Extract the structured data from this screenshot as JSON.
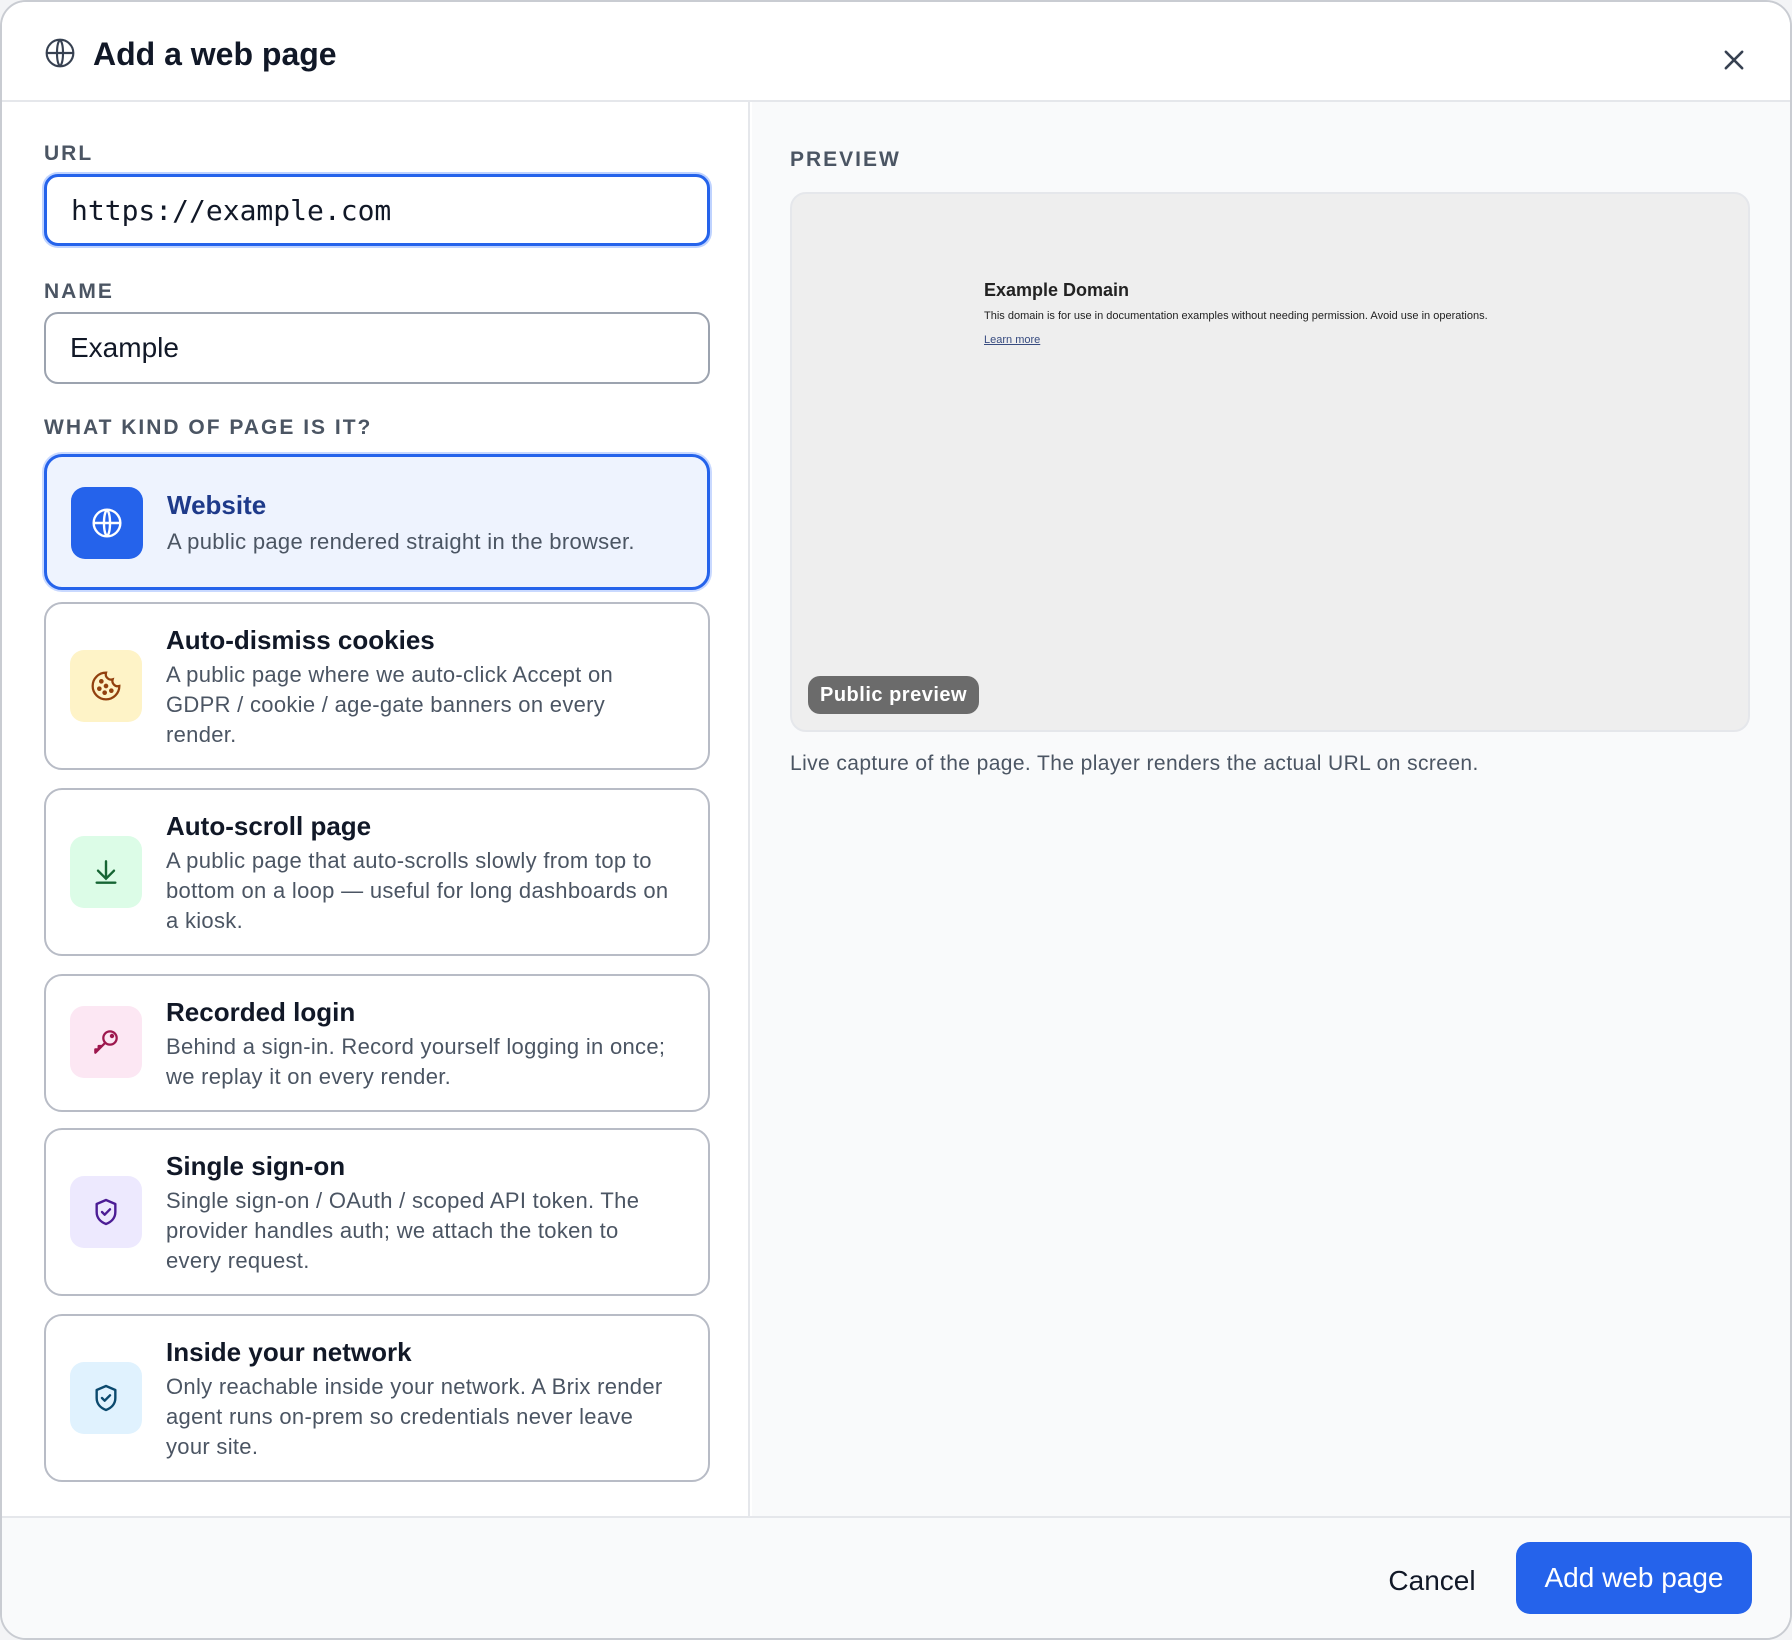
{
  "header": {
    "title": "Add a web page",
    "title_icon": "globe-icon",
    "close_icon": "close-icon"
  },
  "form": {
    "url_label": "URL",
    "url_value": "https://example.com",
    "name_label": "NAME",
    "name_value": "Example",
    "kind_label": "WHAT KIND OF PAGE IS IT?",
    "selected_option": "Website",
    "options": [
      {
        "title": "Website",
        "desc": "A public page rendered straight in the browser.",
        "icon": "globe-icon",
        "icon_bg": "#2563eb",
        "icon_color": "#ffffff"
      },
      {
        "title": "Auto-dismiss cookies",
        "desc": "A public page where we auto-click Accept on GDPR / cookie / age-gate banners on every render.",
        "icon": "cookie-icon",
        "icon_bg": "#fef3c7",
        "icon_color": "#92400e"
      },
      {
        "title": "Auto-scroll page",
        "desc": "A public page that auto-scrolls slowly from top to bottom on a loop — useful for long dashboards on a kiosk.",
        "icon": "arrow-down-icon",
        "icon_bg": "#dcfce7",
        "icon_color": "#166534"
      },
      {
        "title": "Recorded login",
        "desc": "Behind a sign-in. Record yourself logging in once; we replay it on every render.",
        "icon": "key-icon",
        "icon_bg": "#fce7f3",
        "icon_color": "#9d174d"
      },
      {
        "title": "Single sign-on",
        "desc": "Single sign-on / OAuth / scoped API token. The provider handles auth; we attach the token to every request.",
        "icon": "shield-check-icon",
        "icon_bg": "#ede9fe",
        "icon_color": "#4c1d95"
      },
      {
        "title": "Inside your network",
        "desc": "Only reachable inside your network. A Brix render agent runs on-prem so credentials never leave your site.",
        "icon": "shield-check-icon",
        "icon_bg": "#e0f2fe",
        "icon_color": "#0c4a6e"
      }
    ]
  },
  "preview": {
    "label": "PREVIEW",
    "page_title": "Example Domain",
    "page_text": "This domain is for use in documentation examples without needing permission. Avoid use in operations.",
    "page_link": "Learn more",
    "badge": "Public preview",
    "caption": "Live capture of the page. The player renders the actual URL on screen."
  },
  "footer": {
    "cancel_label": "Cancel",
    "submit_label": "Add web page",
    "accent": "#2563eb"
  }
}
